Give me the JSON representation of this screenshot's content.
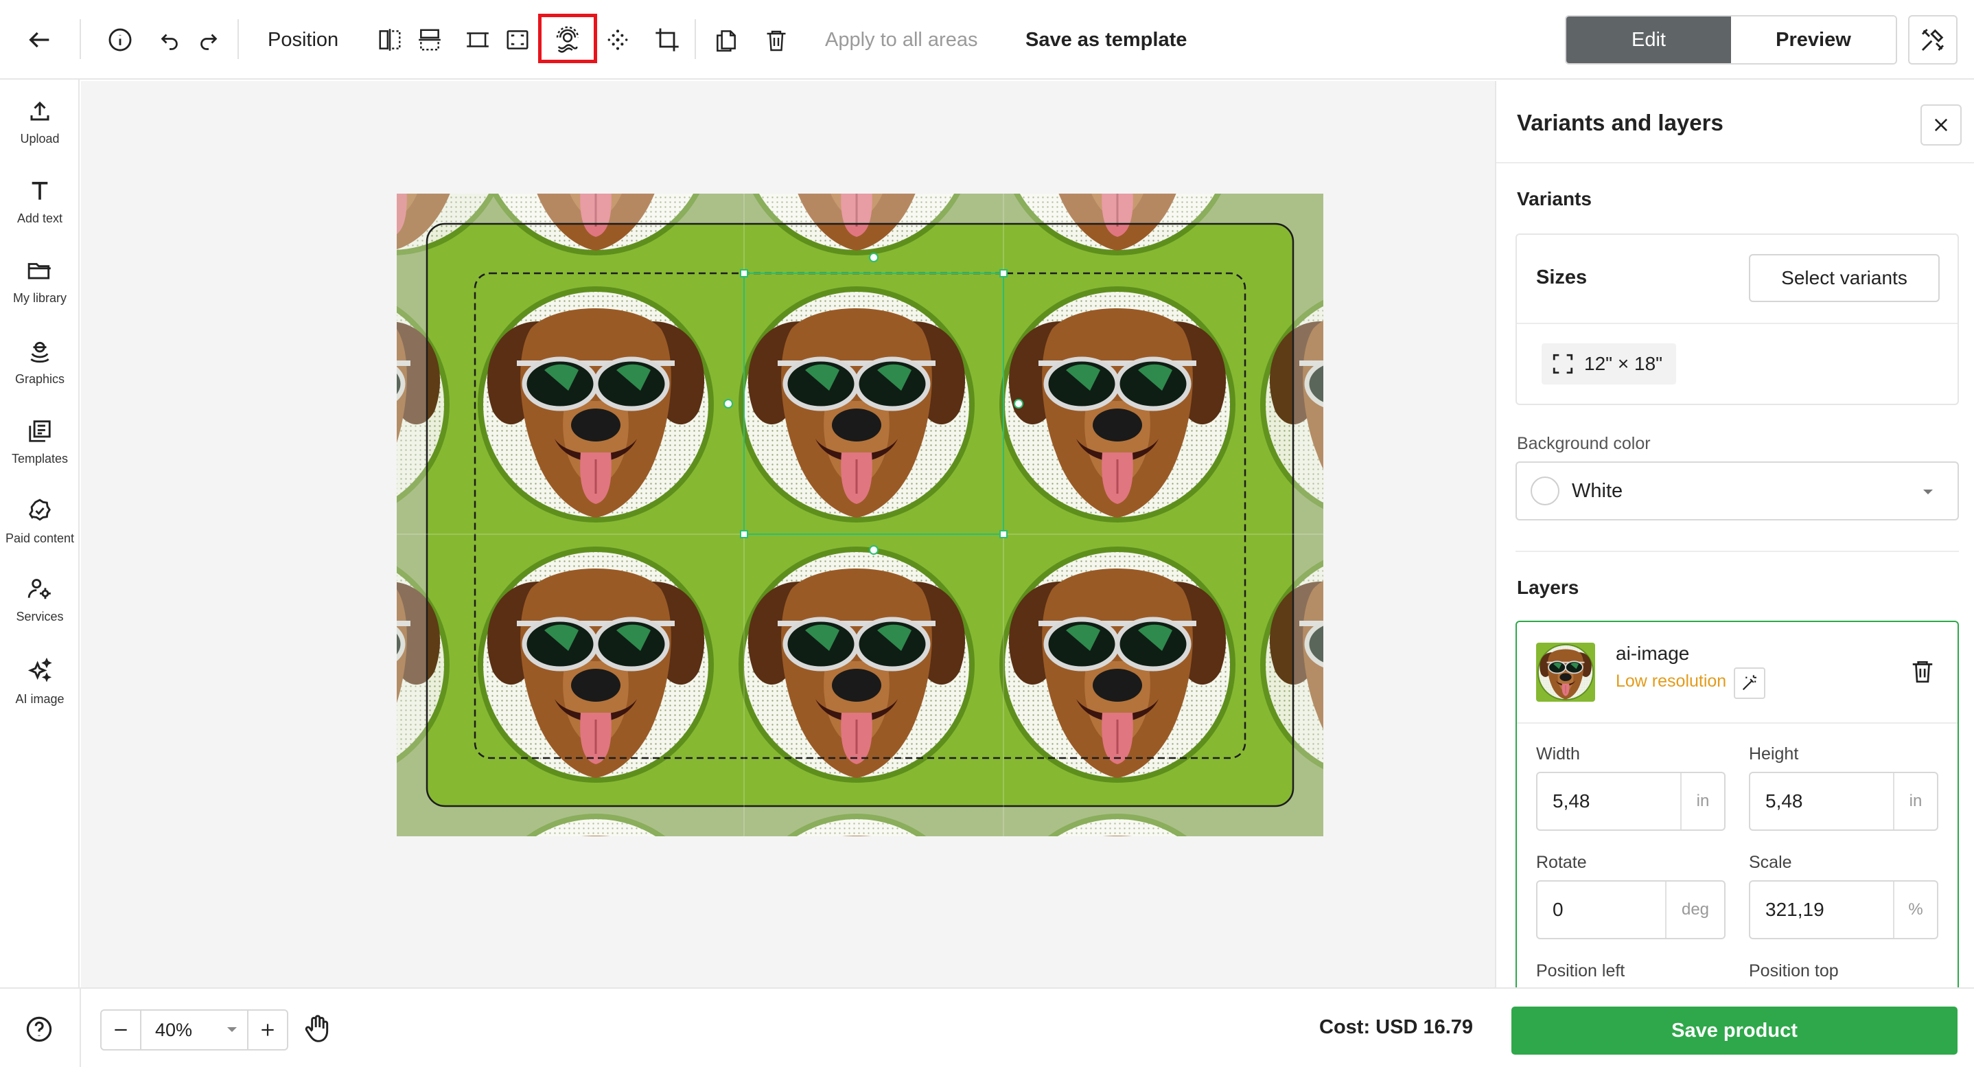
{
  "toolbar": {
    "position_label": "Position",
    "apply_all_label": "Apply to all areas",
    "save_template_label": "Save as template",
    "edit_label": "Edit",
    "preview_label": "Preview"
  },
  "sidebar": {
    "items": [
      {
        "label": "Upload",
        "icon": "upload-icon"
      },
      {
        "label": "Add text",
        "icon": "text-icon"
      },
      {
        "label": "My library",
        "icon": "folder-icon"
      },
      {
        "label": "Graphics",
        "icon": "graphics-icon"
      },
      {
        "label": "Templates",
        "icon": "templates-icon"
      },
      {
        "label": "Paid content",
        "icon": "badge-check-icon"
      },
      {
        "label": "Services",
        "icon": "services-icon"
      },
      {
        "label": "AI image",
        "icon": "sparkle-icon"
      }
    ]
  },
  "panel": {
    "title": "Variants and layers",
    "variants_title": "Variants",
    "sizes_label": "Sizes",
    "select_variants_label": "Select variants",
    "size_value": "12\" × 18\"",
    "bg_color_label": "Background color",
    "bg_color_value": "White",
    "layers_title": "Layers",
    "layer": {
      "name": "ai-image",
      "warning": "Low resolution",
      "warning_color": "#e39b1b"
    },
    "width_label": "Width",
    "width_value": "5,48",
    "width_unit": "in",
    "height_label": "Height",
    "height_value": "5,48",
    "height_unit": "in",
    "rotate_label": "Rotate",
    "rotate_value": "0",
    "rotate_unit": "deg",
    "scale_label": "Scale",
    "scale_value": "321,19",
    "scale_unit": "%",
    "pos_left_label": "Position left",
    "pos_top_label": "Position top"
  },
  "bottom": {
    "zoom_value": "40%",
    "cost_text": "Cost: USD 16.79",
    "save_product_label": "Save product"
  },
  "colors": {
    "accent_green": "#2ea84a",
    "edit_active_bg": "#5f6467",
    "highlight_red": "#e8141c",
    "canvas_green": "#86b832"
  }
}
